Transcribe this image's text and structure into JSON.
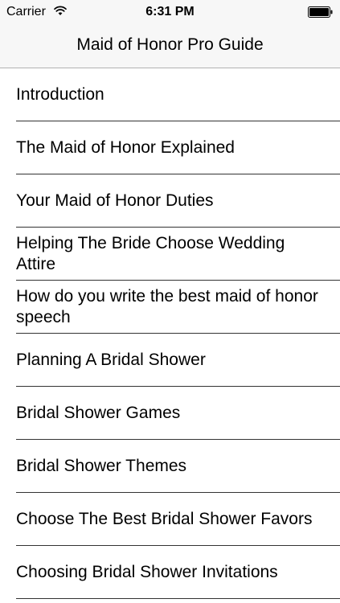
{
  "status_bar": {
    "carrier": "Carrier",
    "time": "6:31 PM",
    "wifi_icon": "wifi-icon",
    "battery_icon": "battery-icon",
    "battery_level": 1.0
  },
  "nav": {
    "title": "Maid of Honor Pro Guide"
  },
  "items": [
    {
      "label": "Introduction"
    },
    {
      "label": "The Maid of Honor Explained"
    },
    {
      "label": "Your Maid of Honor Duties"
    },
    {
      "label": "Helping The Bride Choose Wedding Attire"
    },
    {
      "label": "How do you write the best maid of honor speech"
    },
    {
      "label": "Planning A Bridal Shower"
    },
    {
      "label": "Bridal Shower Games"
    },
    {
      "label": "Bridal Shower Themes"
    },
    {
      "label": "Choose The Best Bridal Shower Favors"
    },
    {
      "label": "Choosing Bridal Shower Invitations"
    }
  ],
  "colors": {
    "bar_background": "#f7f7f7",
    "separator": "#333333",
    "text": "#000000"
  }
}
